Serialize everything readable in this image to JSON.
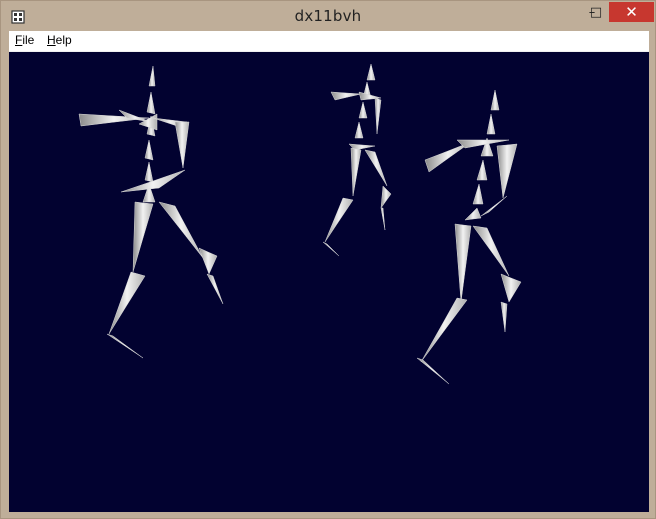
{
  "window": {
    "title": "dx11bvh",
    "controls": {
      "minimize": "–",
      "maximize": "□",
      "close": "✕"
    }
  },
  "menu": {
    "items": [
      {
        "accel": "F",
        "rest": "ile"
      },
      {
        "accel": "H",
        "rest": "elp"
      }
    ]
  },
  "viewport": {
    "background": "#020230",
    "figures": [
      "skeleton-left",
      "skeleton-middle",
      "skeleton-right"
    ]
  }
}
